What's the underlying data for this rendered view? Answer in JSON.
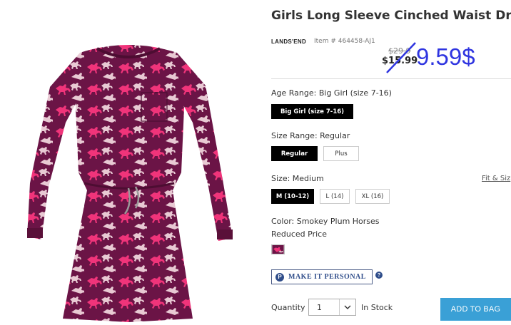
{
  "product": {
    "title": "Girls Long Sleeve Cinched Waist Dress",
    "brand": "LANDS'END",
    "item_number": "Item # 464458-AJ1",
    "price_original": "$29.9",
    "price_sale": "$15.99",
    "price_annotation": "9.59$"
  },
  "options": {
    "age_range_label": "Age Range: Big Girl (size 7-16)",
    "age_range_values": [
      "Big Girl (size 7-16)"
    ],
    "size_range_label": "Size Range: Regular",
    "size_range_values": [
      "Regular",
      "Plus"
    ],
    "size_label": "Size: Medium",
    "fit_link": "Fit & Siz",
    "size_values": [
      "M (10-12)",
      "L (14)",
      "XL (16)"
    ],
    "color_label": "Color: Smokey Plum Horses",
    "reduced_label": "Reduced Price"
  },
  "personalize": {
    "icon_letter": "P",
    "label": "MAKE IT PERSONAL",
    "help_icon": "?"
  },
  "purchase": {
    "quantity_label": "Quantity",
    "quantity_value": "1",
    "stock_status": "In Stock",
    "add_to_bag": "ADD TO BAG"
  },
  "colors": {
    "dress_base": "#6b1446",
    "horse_pink": "#f0347a",
    "horse_white": "#e8c9d3",
    "add_button": "#3aa0d6",
    "annotation": "#2f35e0"
  }
}
